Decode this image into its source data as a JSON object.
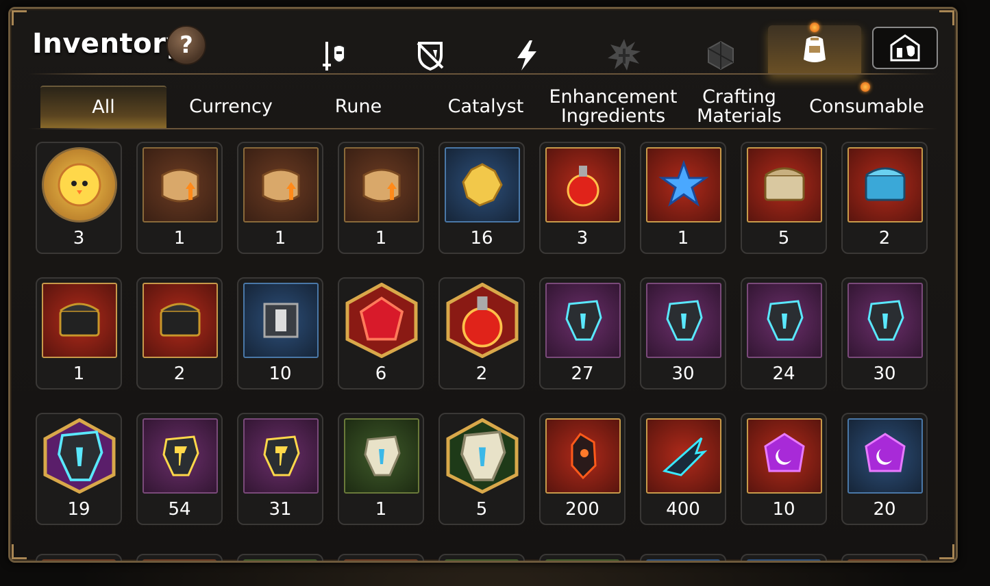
{
  "header": {
    "title": "Inventory",
    "help_label": "?"
  },
  "categories": [
    {
      "name": "equipment-icon",
      "active": false
    },
    {
      "name": "shield-off-icon",
      "active": false
    },
    {
      "name": "lightning-icon",
      "active": false
    },
    {
      "name": "rune-splash-icon",
      "active": false
    },
    {
      "name": "cube-icon",
      "active": false
    },
    {
      "name": "backpack-icon",
      "active": true
    },
    {
      "name": "storage-icon",
      "active": false
    }
  ],
  "tabs": [
    {
      "label": "All",
      "active": true
    },
    {
      "label": "Currency"
    },
    {
      "label": "Rune"
    },
    {
      "label": "Catalyst"
    },
    {
      "label": "Enhancement Ingredients"
    },
    {
      "label": "Crafting Materials"
    },
    {
      "label": "Consumable",
      "notify": true
    }
  ],
  "items": [
    [
      {
        "icon": "chick-token-icon",
        "style": "circle",
        "count": "3"
      },
      {
        "icon": "scroll-fire-icon",
        "style": "bronze",
        "count": "1"
      },
      {
        "icon": "scroll-rainbow-icon",
        "style": "bronze",
        "count": "1"
      },
      {
        "icon": "scroll-gold-icon",
        "style": "bronze",
        "count": "1"
      },
      {
        "icon": "gold-crystal-icon",
        "style": "blue",
        "count": "16"
      },
      {
        "icon": "red-potion-icon",
        "style": "red",
        "count": "3"
      },
      {
        "icon": "star-potion-icon",
        "style": "red",
        "count": "1"
      },
      {
        "icon": "white-chest-icon",
        "style": "red",
        "count": "5"
      },
      {
        "icon": "blue-chest-icon",
        "style": "red",
        "count": "2"
      }
    ],
    [
      {
        "icon": "gold-chest-icon",
        "style": "red",
        "count": "1"
      },
      {
        "icon": "gold-chest-icon",
        "style": "red",
        "count": "2"
      },
      {
        "icon": "silver-box-icon",
        "style": "blue",
        "count": "10"
      },
      {
        "icon": "red-gem-icon",
        "style": "hex-red",
        "count": "6"
      },
      {
        "icon": "pink-potion-icon",
        "style": "hex-red",
        "count": "2"
      },
      {
        "icon": "rune-sword-icon",
        "style": "purple",
        "count": "27"
      },
      {
        "icon": "rune-helm-icon",
        "style": "purple",
        "count": "30"
      },
      {
        "icon": "rune-armor-icon",
        "style": "purple",
        "count": "24"
      },
      {
        "icon": "rune-boot-icon",
        "style": "purple",
        "count": "30"
      }
    ],
    [
      {
        "icon": "rune-star-icon",
        "style": "hex-purple",
        "count": "19"
      },
      {
        "icon": "rune-hammer-icon",
        "style": "purple",
        "count": "54"
      },
      {
        "icon": "rune-bolt-icon",
        "style": "purple",
        "count": "31"
      },
      {
        "icon": "stone-sword-icon",
        "style": "green",
        "count": "1"
      },
      {
        "icon": "stone-star-icon",
        "style": "hex-green",
        "count": "5"
      },
      {
        "icon": "magma-stone-icon",
        "style": "red",
        "count": "200"
      },
      {
        "icon": "dragon-claw-icon",
        "style": "red",
        "count": "400"
      },
      {
        "icon": "moon-gem-icon",
        "style": "red",
        "count": "10"
      },
      {
        "icon": "moon-crystal-icon",
        "style": "blue",
        "count": "20"
      }
    ]
  ],
  "colors": {
    "panel_border": "#6e5a3c",
    "accent_gold": "#c8962a",
    "text": "#ffffff"
  }
}
